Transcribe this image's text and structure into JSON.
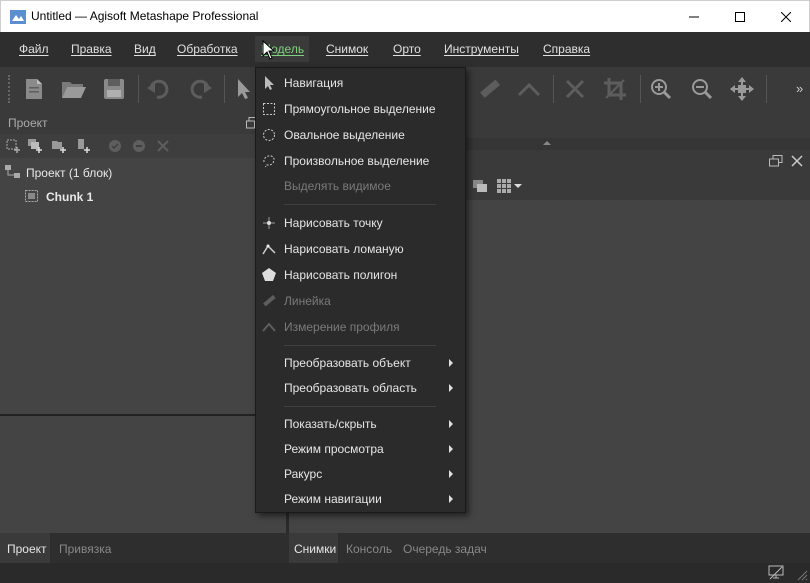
{
  "window": {
    "title": "Untitled — Agisoft Metashape Professional",
    "controls": [
      "minimize",
      "maximize",
      "close"
    ]
  },
  "menubar": {
    "items": [
      {
        "label": "Файл"
      },
      {
        "label": "Правка"
      },
      {
        "label": "Вид"
      },
      {
        "label": "Обработка"
      },
      {
        "label": "Модель"
      },
      {
        "label": "Снимок"
      },
      {
        "label": "Орто"
      },
      {
        "label": "Инструменты"
      },
      {
        "label": "Справка"
      }
    ],
    "active_index": 4
  },
  "toolbar": {
    "buttons": [
      "new-icon",
      "open-icon",
      "save-icon",
      "undo-icon",
      "redo-icon",
      "select-icon",
      "ruler-icon",
      "profile-icon",
      "delete-icon",
      "crop-icon",
      "zoom-in-icon",
      "zoom-out-icon",
      "reset-view-icon"
    ],
    "overflow": "»"
  },
  "project_panel": {
    "title": "Проект",
    "root": "Проект (1 блок)",
    "chunk": "Chunk 1"
  },
  "model_menu": {
    "items": [
      {
        "label": "Навигация",
        "icon": "cursor-arrow-icon",
        "enabled": true,
        "submenu": false
      },
      {
        "label": "Прямоугольное выделение",
        "icon": "rect-select-icon",
        "enabled": true,
        "submenu": false
      },
      {
        "label": "Овальное выделение",
        "icon": "oval-select-icon",
        "enabled": true,
        "submenu": false
      },
      {
        "label": "Произвольное выделение",
        "icon": "free-select-icon",
        "enabled": true,
        "submenu": false
      },
      {
        "label": "Выделять видимое",
        "icon": "",
        "enabled": false,
        "submenu": false
      },
      {
        "label": "Нарисовать точку",
        "icon": "draw-point-icon",
        "enabled": true,
        "submenu": false
      },
      {
        "label": "Нарисовать ломаную",
        "icon": "draw-polyline-icon",
        "enabled": true,
        "submenu": false
      },
      {
        "label": "Нарисовать полигон",
        "icon": "draw-polygon-icon",
        "enabled": true,
        "submenu": false
      },
      {
        "label": "Линейка",
        "icon": "ruler-icon",
        "enabled": false,
        "submenu": false
      },
      {
        "label": "Измерение профиля",
        "icon": "profile-icon",
        "enabled": false,
        "submenu": false
      },
      {
        "label": "Преобразовать объект",
        "icon": "",
        "enabled": true,
        "submenu": true
      },
      {
        "label": "Преобразовать область",
        "icon": "",
        "enabled": true,
        "submenu": true
      },
      {
        "label": "Показать/скрыть",
        "icon": "",
        "enabled": true,
        "submenu": true
      },
      {
        "label": "Режим просмотра",
        "icon": "",
        "enabled": true,
        "submenu": true
      },
      {
        "label": "Ракурс",
        "icon": "",
        "enabled": true,
        "submenu": true
      },
      {
        "label": "Режим навигации",
        "icon": "",
        "enabled": true,
        "submenu": true
      }
    ]
  },
  "bottom_left_tabs": [
    {
      "label": "Проект",
      "active": true
    },
    {
      "label": "Привязка",
      "active": false
    }
  ],
  "bottom_right_tabs": [
    {
      "label": "Снимки",
      "active": true
    },
    {
      "label": "Консоль",
      "active": false
    },
    {
      "label": "Очередь задач",
      "active": false
    }
  ],
  "colors": {
    "active_menu": "#7fd17f",
    "menu_bg": "#2b2b2b",
    "panel_bg": "#444444"
  }
}
